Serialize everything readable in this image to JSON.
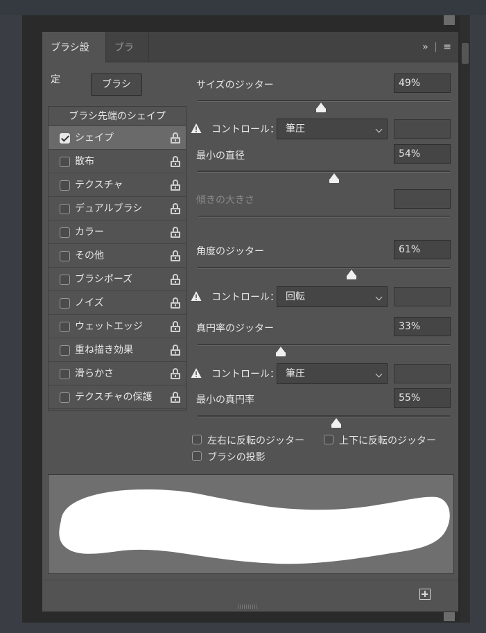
{
  "tabs": {
    "active": "ブラシ設定",
    "inactive": "ブラシ"
  },
  "tab_menu": {
    "expand": "»",
    "separator": "|",
    "menu": "≡"
  },
  "brush_button": "ブラシ",
  "categories": {
    "header": "ブラシ先端のシェイプ",
    "items": [
      {
        "label": "シェイプ",
        "checked": true
      },
      {
        "label": "散布",
        "checked": false
      },
      {
        "label": "テクスチャ",
        "checked": false
      },
      {
        "label": "デュアルブラシ",
        "checked": false
      },
      {
        "label": "カラー",
        "checked": false
      },
      {
        "label": "その他",
        "checked": false
      },
      {
        "label": "ブラシポーズ",
        "checked": false
      },
      {
        "label": "ノイズ",
        "checked": false
      },
      {
        "label": "ウェットエッジ",
        "checked": false
      },
      {
        "label": "重ね描き効果",
        "checked": false
      },
      {
        "label": "滑らかさ",
        "checked": false
      },
      {
        "label": "テクスチャの保護",
        "checked": false
      }
    ]
  },
  "settings": {
    "size_jitter": {
      "label": "サイズのジッター",
      "value": "49%",
      "level": 0.49
    },
    "control1": {
      "label": "コントロール：",
      "value": "筆圧"
    },
    "min_diameter": {
      "label": "最小の直径",
      "value": "54%",
      "level": 0.54
    },
    "tilt_scale": {
      "label": "傾きの大きさ",
      "value": ""
    },
    "angle_jitter": {
      "label": "角度のジッター",
      "value": "61%",
      "level": 0.61
    },
    "control2": {
      "label": "コントロール：",
      "value": "回転"
    },
    "roundness_jitter": {
      "label": "真円率のジッター",
      "value": "33%",
      "level": 0.33
    },
    "control3": {
      "label": "コントロール：",
      "value": "筆圧"
    },
    "min_roundness": {
      "label": "最小の真円率",
      "value": "55%",
      "level": 0.55
    }
  },
  "options": {
    "flip_x": "左右に反転のジッター",
    "flip_y": "上下に反転のジッター",
    "projection": "ブラシの投影"
  },
  "icons": {
    "lock": "lock-icon",
    "warning": "warning-icon",
    "add": "new-brush-icon"
  }
}
